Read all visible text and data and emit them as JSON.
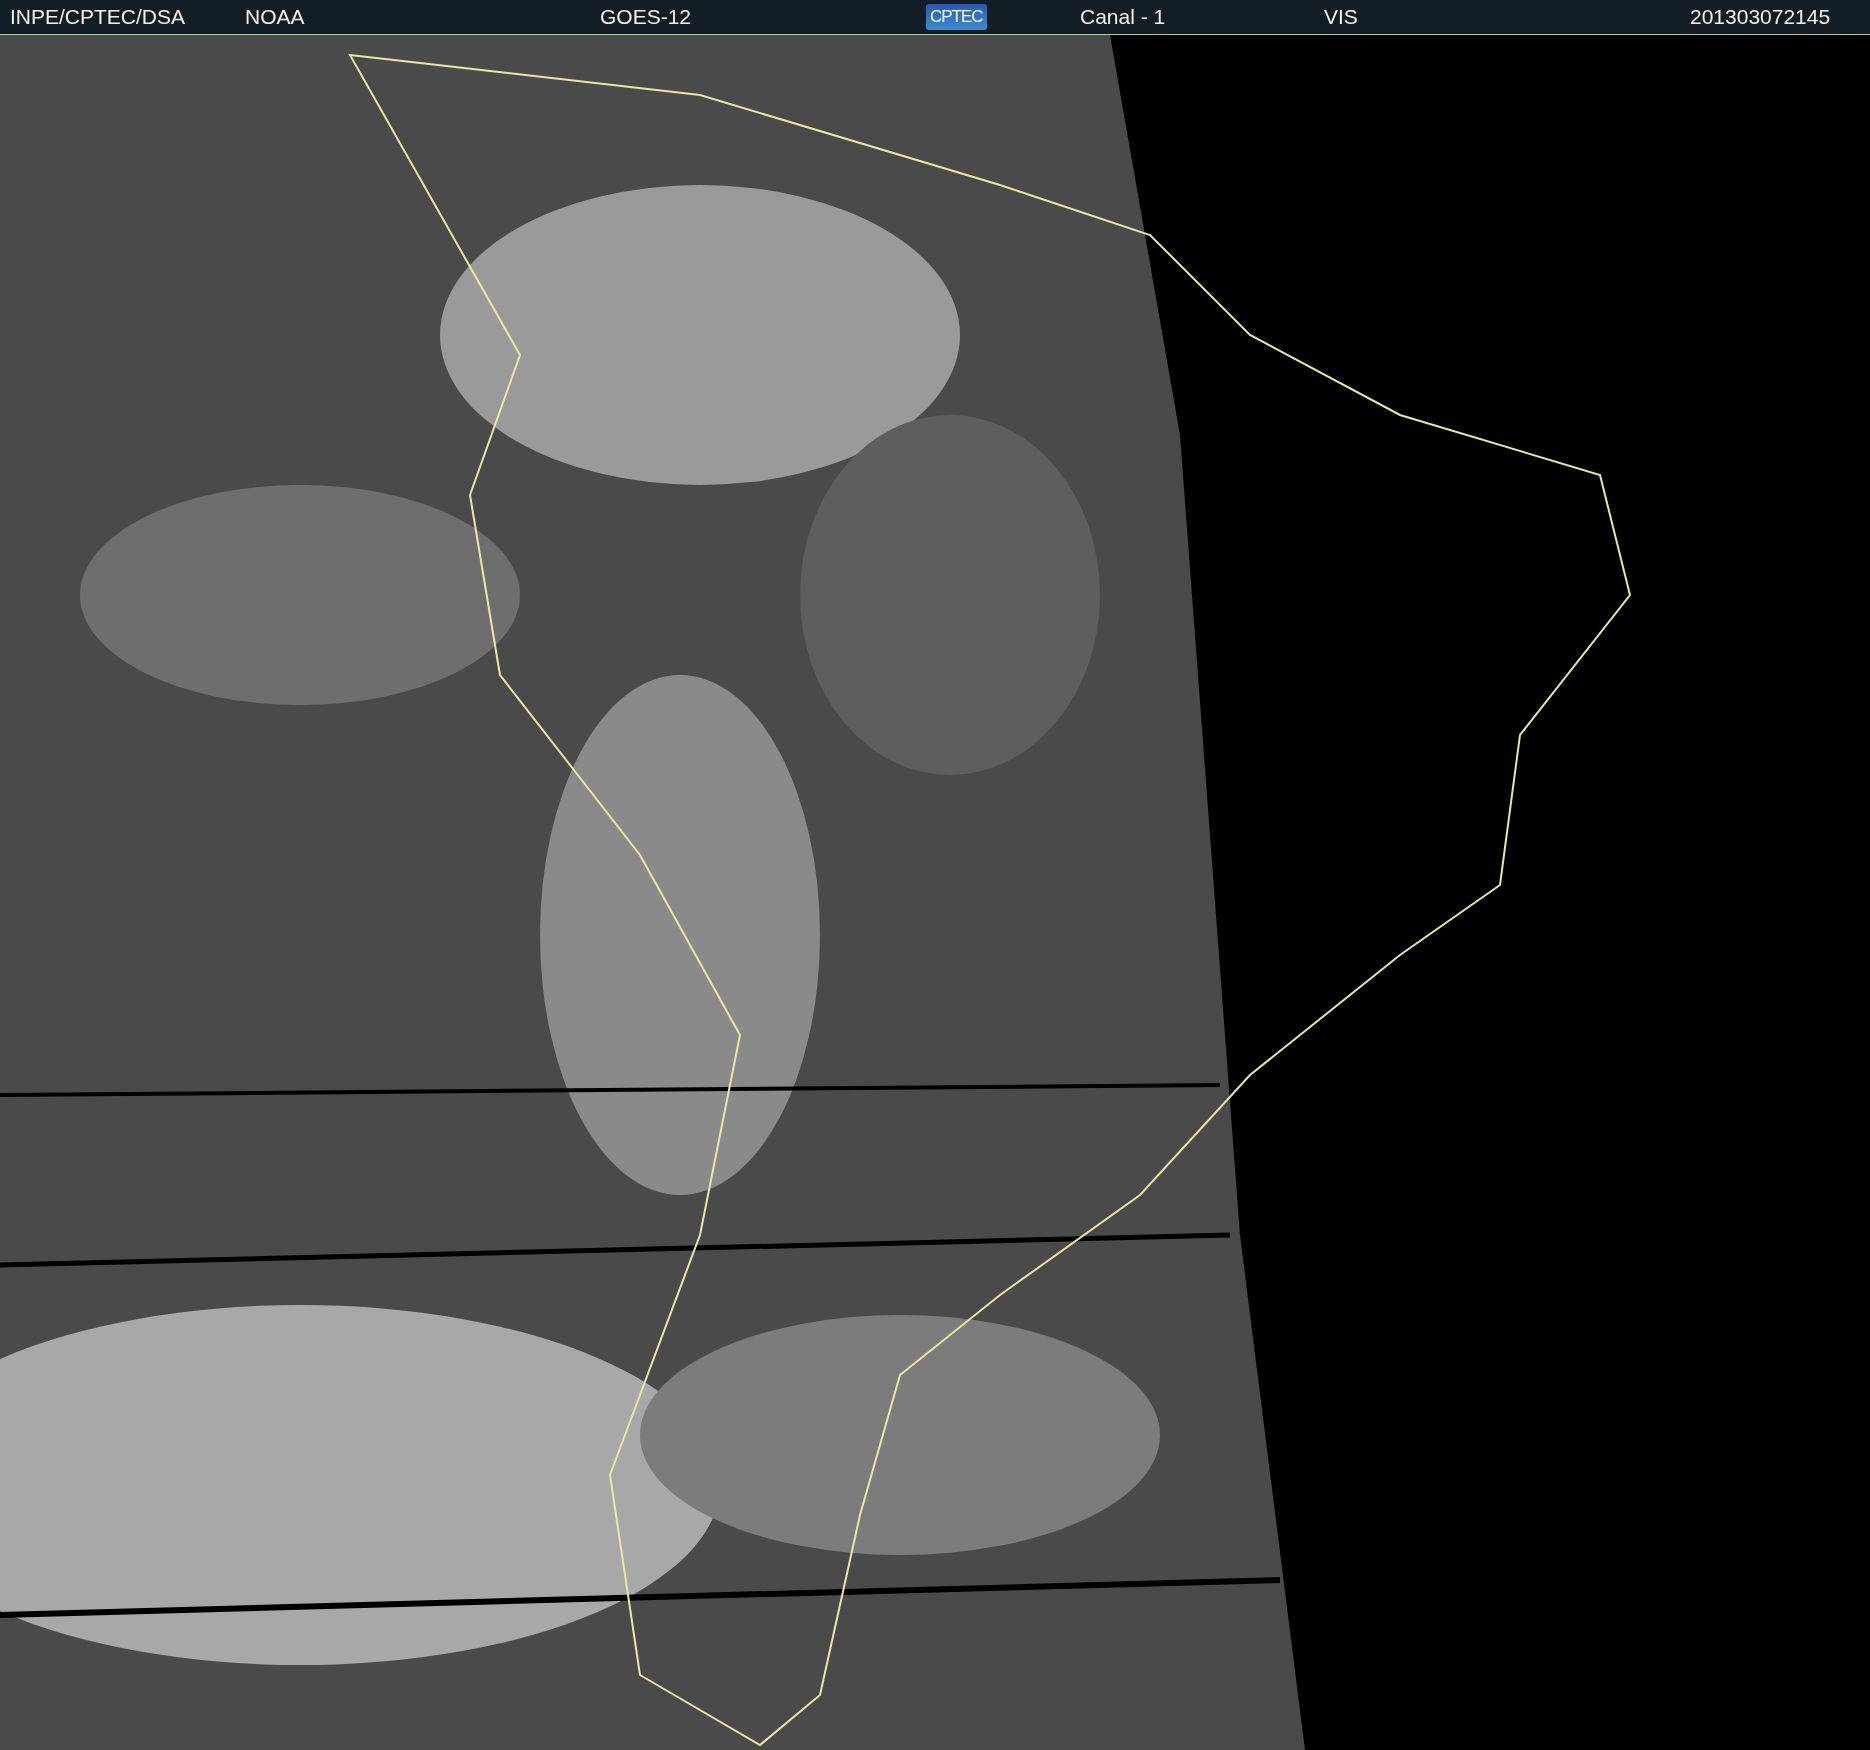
{
  "header": {
    "source": "INPE/CPTEC/DSA",
    "agency": "NOAA",
    "satellite": "GOES-12",
    "logo_text": "CPTEC",
    "channel": "Canal - 1",
    "band": "VIS",
    "timestamp": "201303072145"
  }
}
